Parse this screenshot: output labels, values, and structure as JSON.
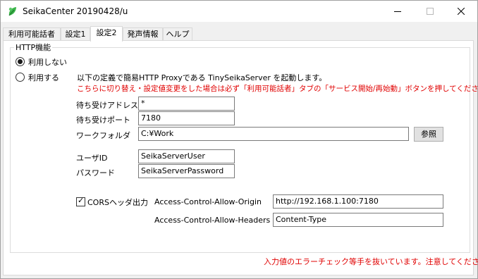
{
  "window": {
    "title": "SeikaCenter 20190428/u"
  },
  "tabs": [
    {
      "label": "利用可能話者"
    },
    {
      "label": "設定1"
    },
    {
      "label": "設定2"
    },
    {
      "label": "発声情報"
    },
    {
      "label": "ヘルプ"
    }
  ],
  "http": {
    "group_title": "HTTP機能",
    "radio_disable_label": "利用しない",
    "radio_enable_label": "利用する",
    "description": "以下の定義で簡易HTTP Proxyである TinySeikaServer を起動します。",
    "warning": "こちらに切り替え・設定値変更をした場合は必ず「利用可能話者」タブの「サービス開始/再始動」ボタンを押してください。",
    "address_label": "待ち受けアドレス",
    "address_value": "*",
    "port_label": "待ち受けポート",
    "port_value": "7180",
    "folder_label": "ワークフォルダ",
    "folder_value": "C:¥Work",
    "browse_label": "参照",
    "user_label": "ユーザID",
    "user_value": "SeikaServerUser",
    "password_label": "パスワード",
    "password_value": "SeikaServerPassword",
    "cors_label": "CORSヘッダ出力",
    "cors_checked": true,
    "origin_label": "Access-Control-Allow-Origin",
    "origin_value": "http://192.168.1.100:7180",
    "headers_label": "Access-Control-Allow-Headers",
    "headers_value": "Content-Type"
  },
  "footer_note": "入力値のエラーチェック等手を抜いています。注意してください。",
  "colors": {
    "warning": "#e00000",
    "icon_green": "#3bb54a"
  },
  "icons": {
    "app": "leaf-icon",
    "minimize": "minimize-icon",
    "maximize": "maximize-icon",
    "close": "close-icon",
    "check": "check-icon"
  }
}
